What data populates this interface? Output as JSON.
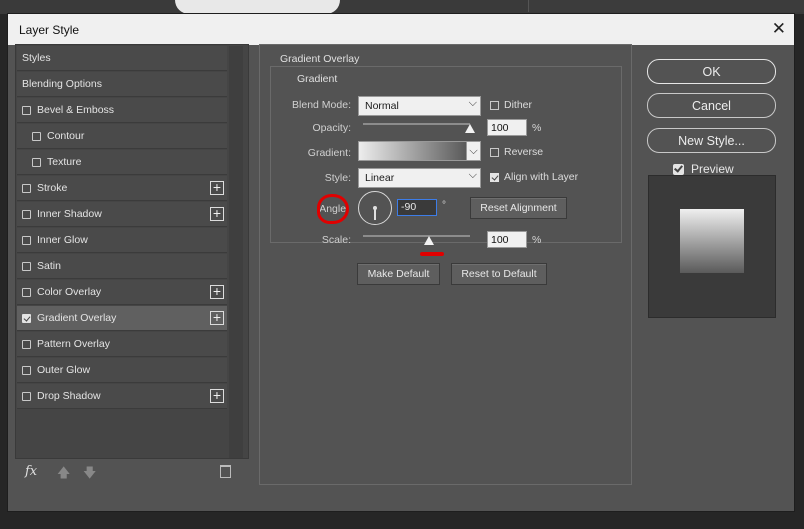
{
  "window": {
    "title": "Layer Style",
    "close_glyph": "✕"
  },
  "sidebar": {
    "items": [
      {
        "label": "Styles",
        "checkbox": false,
        "checked": false,
        "plus": false,
        "indent": false,
        "active": false
      },
      {
        "label": "Blending Options",
        "checkbox": false,
        "checked": false,
        "plus": false,
        "indent": false,
        "active": false
      },
      {
        "label": "Bevel & Emboss",
        "checkbox": true,
        "checked": false,
        "plus": false,
        "indent": false,
        "active": false
      },
      {
        "label": "Contour",
        "checkbox": true,
        "checked": false,
        "plus": false,
        "indent": true,
        "active": false
      },
      {
        "label": "Texture",
        "checkbox": true,
        "checked": false,
        "plus": false,
        "indent": true,
        "active": false
      },
      {
        "label": "Stroke",
        "checkbox": true,
        "checked": false,
        "plus": true,
        "indent": false,
        "active": false
      },
      {
        "label": "Inner Shadow",
        "checkbox": true,
        "checked": false,
        "plus": true,
        "indent": false,
        "active": false
      },
      {
        "label": "Inner Glow",
        "checkbox": true,
        "checked": false,
        "plus": false,
        "indent": false,
        "active": false
      },
      {
        "label": "Satin",
        "checkbox": true,
        "checked": false,
        "plus": false,
        "indent": false,
        "active": false
      },
      {
        "label": "Color Overlay",
        "checkbox": true,
        "checked": false,
        "plus": true,
        "indent": false,
        "active": false
      },
      {
        "label": "Gradient Overlay",
        "checkbox": true,
        "checked": true,
        "plus": true,
        "indent": false,
        "active": true
      },
      {
        "label": "Pattern Overlay",
        "checkbox": true,
        "checked": false,
        "plus": false,
        "indent": false,
        "active": false
      },
      {
        "label": "Outer Glow",
        "checkbox": true,
        "checked": false,
        "plus": false,
        "indent": false,
        "active": false
      },
      {
        "label": "Drop Shadow",
        "checkbox": true,
        "checked": false,
        "plus": true,
        "indent": false,
        "active": false
      }
    ],
    "footer": {
      "fx_label": "fx",
      "up_arrow": "🡅",
      "down_arrow": "🡇"
    }
  },
  "panel": {
    "section_title": "Gradient Overlay",
    "group_title": "Gradient",
    "blend_mode": {
      "label": "Blend Mode:",
      "value": "Normal"
    },
    "dither": {
      "label": "Dither",
      "checked": false
    },
    "opacity": {
      "label": "Opacity:",
      "value": "100",
      "unit": "%",
      "level": 1.0
    },
    "gradient": {
      "label": "Gradient:"
    },
    "reverse": {
      "label": "Reverse",
      "checked": false
    },
    "style": {
      "label": "Style:",
      "value": "Linear"
    },
    "align_with_layer": {
      "label": "Align with Layer",
      "checked": true
    },
    "angle": {
      "label": "Angle:",
      "value": "-90",
      "unit": "°"
    },
    "reset_alignment": "Reset Alignment",
    "scale": {
      "label": "Scale:",
      "value": "100",
      "unit": "%"
    },
    "make_default": "Make Default",
    "reset_to_default": "Reset to Default",
    "chevron": "⌵"
  },
  "actions": {
    "ok": "OK",
    "cancel": "Cancel",
    "new_style": "New Style...",
    "preview": {
      "label": "Preview",
      "checked": true
    }
  },
  "colors": {
    "annotation": "#e00000",
    "focus": "#3d7de8"
  }
}
